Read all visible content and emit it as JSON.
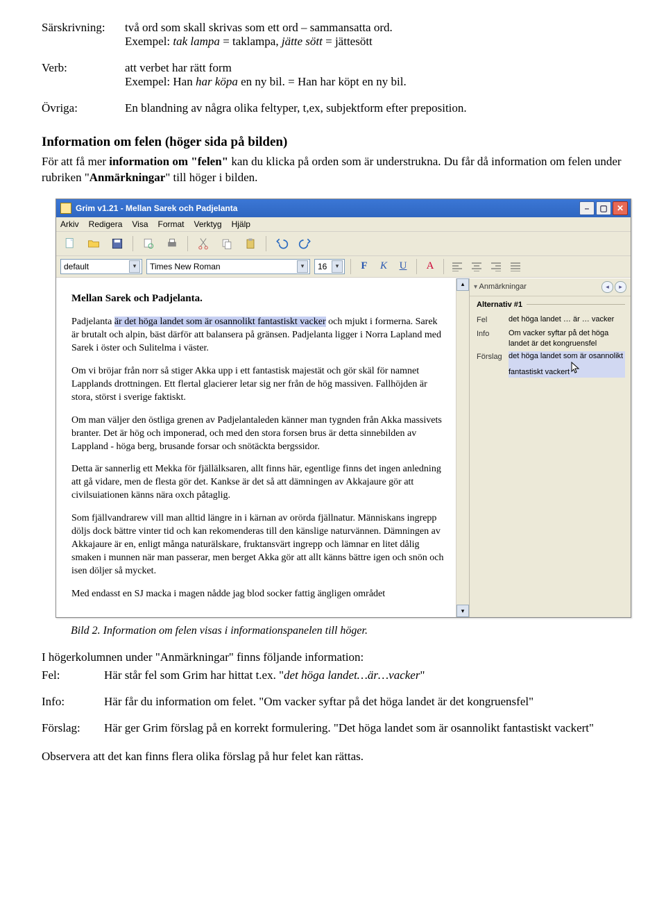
{
  "defs": {
    "sars_label": "Särskrivning:",
    "sars_text_1": "två ord som skall skrivas som ett ord – sammansatta ord.",
    "sars_text_2a": "Exempel: ",
    "sars_text_2b": "tak lampa",
    "sars_text_2c": " = taklampa, ",
    "sars_text_2d": "jätte sött",
    "sars_text_2e": " = jättesött",
    "verb_label": "Verb:",
    "verb_text_1": "att verbet har rätt form",
    "verb_text_2a": "Exempel: Han ",
    "verb_text_2b": "har köpa",
    "verb_text_2c": " en ny bil. = Han har köpt en ny bil.",
    "ovriga_label": "Övriga:",
    "ovriga_text": "En blandning av några olika feltyper, t,ex, subjektform efter preposition."
  },
  "section_heading": "Information om felen (höger sida på bilden)",
  "section_para_a": "För att få mer ",
  "section_para_b": "information om \"felen\"",
  "section_para_c": " kan du klicka på orden som är understrukna. Du får då information om felen under rubriken \"",
  "section_para_d": "Anmärkningar",
  "section_para_e": "\" till höger i bilden.",
  "app": {
    "title": "Grim v1.21 - Mellan Sarek och Padjelanta",
    "menu": [
      "Arkiv",
      "Redigera",
      "Visa",
      "Format",
      "Verktyg",
      "Hjälp"
    ],
    "style": "default",
    "font": "Times New Roman",
    "size": "16",
    "side_head": "Anmärkningar",
    "alt_title": "Alternativ #1",
    "fel_k": "Fel",
    "fel_v": "det höga landet  …  är  …  vacker",
    "info_k": "Info",
    "info_v": "Om vacker syftar på det höga landet är det kongruensfel",
    "forslag_k": "Förslag",
    "forslag_v": "det höga landet som är osannolikt fantastiskt vackert"
  },
  "editor": {
    "title": "Mellan Sarek och Padjelanta.",
    "p1a": "Padjelanta ",
    "p1b": "är det höga landet som är osannolikt fantastiskt vacker",
    "p1c": " och mjukt i formerna. Sarek är brutalt och alpin, bäst därför att balansera på gränsen. Padjelanta ligger i Norra Lapland med Sarek i öster och Sulitelma i väster.",
    "p2": "Om vi bröjar från norr så stiger Akka upp i ett fantastisk majestät och gör skäl för namnet Lapplands drottningen. Ett flertal glacierer letar sig ner från de hög massiven. Fallhöjden är stora, störst i sverige faktiskt.",
    "p3": "Om man väljer den östliga grenen av Padjelantaleden känner man tygnden från Akka massivets branter. Det är hög och imponerad, och med den stora forsen brus är detta sinnebilden av Lappland - höga berg, brusande forsar och snötäckta bergssidor.",
    "p4": "Detta är sannerlig ett Mekka för fjällälksaren, allt finns här, egentlige finns det ingen anledning att gå vidare, men de flesta gör det. Kankse är det så att dämningen av Akkajaure gör att civilsuiationen känns nära oxch påtaglig.",
    "p5": "Som fjällvandrarew vill man alltid längre in i kärnan av orörda fjällnatur. Människans ingrepp döljs dock bättre vinter tid och kan rekomenderas till den känslige naturvännen. Dämningen av Akkajaure är en, enligt många naturälskare, fruktansvärt ingrepp och lämnar en litet dålig smaken i munnen när man passerar, men berget Akka gör att allt känns bättre igen och snön och isen döljer så mycket.",
    "p6": "Med endasst en SJ macka i magen nådde jag blod socker fattig ängligen området"
  },
  "caption": "Bild 2. Information om felen visas i informationspanelen till höger.",
  "after": {
    "intro": "I högerkolumnen under \"Anmärkningar\" finns följande information:",
    "fel_k": "Fel:",
    "fel_v_a": "Här står fel som Grim har hittat t.ex. \"",
    "fel_v_b": "det höga landet…är…vacker",
    "fel_v_c": "\"",
    "info_k": "Info:",
    "info_v": "Här får du information om felet. \"Om vacker syftar på det höga landet är det kongruensfel\"",
    "forslag_k": "Förslag:",
    "forslag_v": "Här ger Grim förslag på en korrekt formulering. \"Det höga landet som är osannolikt fantastiskt vackert\"",
    "obs": "Observera att det kan finns flera olika förslag på hur felet kan rättas."
  }
}
